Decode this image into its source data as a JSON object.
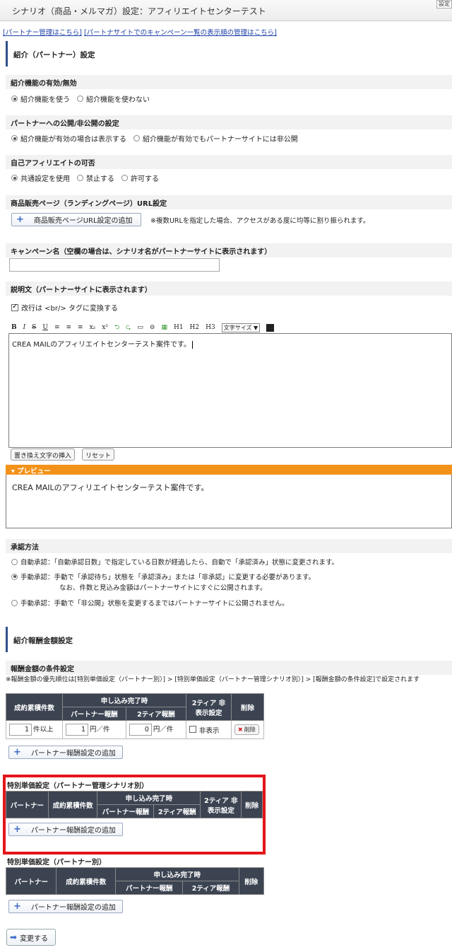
{
  "header": {
    "title": "シナリオ（商品・メルマガ）設定：アフィリエイトセンターテスト",
    "corner_button": "設定"
  },
  "links": [
    "[パートナー管理はこちら]",
    "[パートナサイトでのキャンペーン一覧の表示順の管理はこちら]"
  ],
  "intro_section": {
    "heading": "紹介（パートナー）設定",
    "feature": {
      "label": "紹介機能の有効/無効",
      "options": [
        "紹介機能を使う",
        "紹介機能を使わない"
      ],
      "selected": 0
    },
    "publish": {
      "label": "パートナーへの公開/非公開の設定",
      "options": [
        "紹介機能が有効の場合は表示する",
        "紹介機能が有効でもパートナーサイトには非公開"
      ],
      "selected": 0
    },
    "self_affiliate": {
      "label": "自己アフィリエイトの可否",
      "options": [
        "共通設定を使用",
        "禁止する",
        "許可する"
      ],
      "selected": 0
    },
    "landing": {
      "label": "商品販売ページ（ランディングページ）URL設定",
      "button": "商品販売ページURL設定の追加",
      "note": "※複数URLを指定した場合、アクセスがある度に均等に割り振られます。"
    },
    "campaign": {
      "label": "キャンペーン名（空欄の場合は、シナリオ名がパートナーサイトに表示されます）",
      "value": ""
    },
    "description": {
      "label": "説明文（パートナーサイトに表示されます）",
      "br_checkbox": "改行は <br/> タグに変換する",
      "br_checked": true,
      "toolbar": [
        "B",
        "I",
        "S",
        "U",
        "≡",
        "≡",
        "≡",
        "x₂",
        "x²",
        "⮌",
        "⮎",
        "▭",
        "⊝",
        "▦",
        "H1",
        "H2",
        "H3"
      ],
      "font_size_select": "文字サイズ ▼",
      "content": "CREA MAILのアフィリエイトセンターテスト案件です。",
      "insert_button": "置き換え文字の挿入",
      "reset_button": "リセット",
      "preview_label": "プレビュー",
      "preview_text": "CREA MAILのアフィリエイトセンターテスト案件です。"
    },
    "approval": {
      "label": "承認方法",
      "options": [
        "自動承認：「自動承認日数」で指定している日数が経過したら、自動で「承認済み」状態に変更されます。",
        "手動承認：手動で「承認待ち」状態を「承認済み」または「非承認」に変更する必要があります。",
        "手動承認：手動で「非公開」状態を変更するまではパートナーサイトに公開されません。"
      ],
      "option2_note": "なお、件数と見込み金額はパートナーサイトにすぐに公開されます。",
      "selected": 1
    }
  },
  "reward_section": {
    "heading": "紹介報酬金額設定",
    "conditions": {
      "label": "報酬金額の条件設定",
      "note": "※報酬金額の優先順位は[特別単価設定（パートナー別）] > [特別単価設定（パートナー管理シナリオ別）] > [報酬金額の条件設定]で設定されます",
      "headers": {
        "count": "成約累積件数",
        "apply": "申し込み完了時",
        "partner_reward": "パートナー報酬",
        "tier2_reward": "2ティア報酬",
        "tier2_hidden": "2ティア 非表示設定",
        "delete": "削除"
      },
      "row": {
        "count": "1",
        "count_suffix": "件以上",
        "reward": "1",
        "reward_suffix": "円／件",
        "tier2": "0",
        "tier2_suffix": "円／件",
        "hidden_label": "非表示",
        "delete_label": "削除"
      },
      "add_button": "パートナー報酬設定の追加"
    },
    "special_scenario": {
      "label": "特別単価設定（パートナー管理シナリオ別）",
      "headers": {
        "partner": "パートナー",
        "count": "成約累積件数",
        "apply": "申し込み完了時",
        "partner_reward": "パートナー報酬",
        "tier2_reward": "2ティア報酬",
        "tier2_hidden": "2ティア 非表示設定",
        "delete": "削除"
      },
      "add_button": "パートナー報酬設定の追加"
    },
    "special_partner": {
      "label": "特別単価設定（パートナー別）",
      "headers": {
        "partner": "パートナー",
        "count": "成約累積件数",
        "apply": "申し込み完了時",
        "partner_reward": "パートナー報酬",
        "tier2_reward": "2ティア報酬",
        "delete": "削除"
      },
      "add_button": "パートナー報酬設定の追加"
    }
  },
  "submit_button": "変更する"
}
